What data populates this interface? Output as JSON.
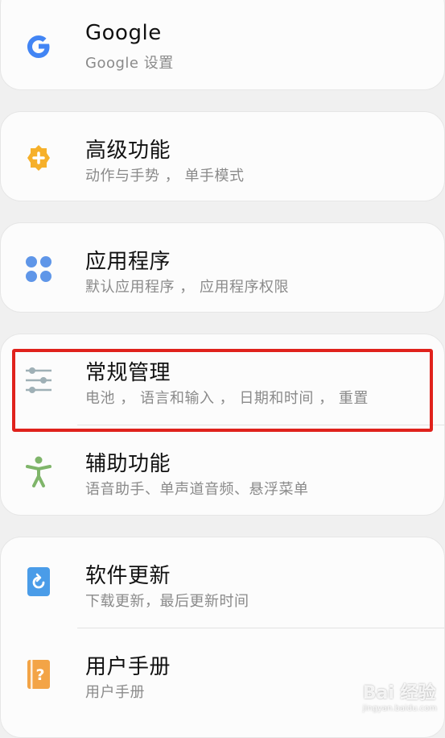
{
  "settings": [
    {
      "title": "Google",
      "subtitle": "Google 设置",
      "icon": "google-icon"
    },
    {
      "title": "高级功能",
      "subtitle": "动作与手势 ， 单手模式",
      "icon": "advanced-features-icon"
    },
    {
      "title": "应用程序",
      "subtitle": "默认应用程序 ， 应用程序权限",
      "icon": "apps-icon"
    },
    {
      "title": "常规管理",
      "subtitle": "电池 ， 语言和输入 ， 日期和时间 ， 重置",
      "icon": "general-management-icon"
    },
    {
      "title": "辅助功能",
      "subtitle": "语音助手、单声道音频、悬浮菜单",
      "icon": "accessibility-icon"
    },
    {
      "title": "软件更新",
      "subtitle": "下载更新，最后更新时间",
      "icon": "software-update-icon"
    },
    {
      "title": "用户手册",
      "subtitle": "用户手册",
      "icon": "user-manual-icon"
    }
  ],
  "watermark": {
    "main": "Bai 经验",
    "sub": "jingyan.baidu.com"
  },
  "colors": {
    "highlight": "#e0221c",
    "google_blue": "#4285f4",
    "advanced_orange": "#f6b02a",
    "apps_blue": "#5f96e8",
    "general_gray": "#9fb0b6",
    "accessibility_green": "#7fb56a",
    "update_blue": "#4a9ce8",
    "manual_orange": "#f3a446"
  }
}
